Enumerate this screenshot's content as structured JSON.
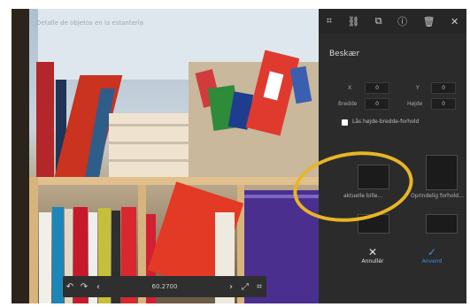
{
  "photo": {
    "caption": "Detalle de objetos en la estantería"
  },
  "image_toolbar": {
    "zoom_label": "60.2700",
    "icons": [
      "undo-icon",
      "redo-icon",
      "prev-icon",
      "next-icon",
      "fit-icon",
      "crop-icon"
    ]
  },
  "panel": {
    "toolbar_icons": [
      "crop-icon",
      "link-icon",
      "copy-icon",
      "info-icon",
      "trash-icon",
      "close-icon"
    ],
    "title": "Beskær",
    "x_label": "X",
    "y_label": "Y",
    "width_label": "Bredde",
    "height_label": "Højde",
    "x_value": "0",
    "y_value": "0",
    "width_value": "0",
    "height_value": "0",
    "keep_ratio_label": "Lås højde-bredde-forhold",
    "presets": [
      {
        "label": "aktuelle bille…"
      },
      {
        "label": "Oprindelig forhold…"
      }
    ],
    "cancel_label": "Annullér",
    "apply_label": "Anvend"
  },
  "colors": {
    "highlight_ring": "#e8b526",
    "apply_blue": "#3b8fe0",
    "panel_bg": "#2b2b2b"
  }
}
